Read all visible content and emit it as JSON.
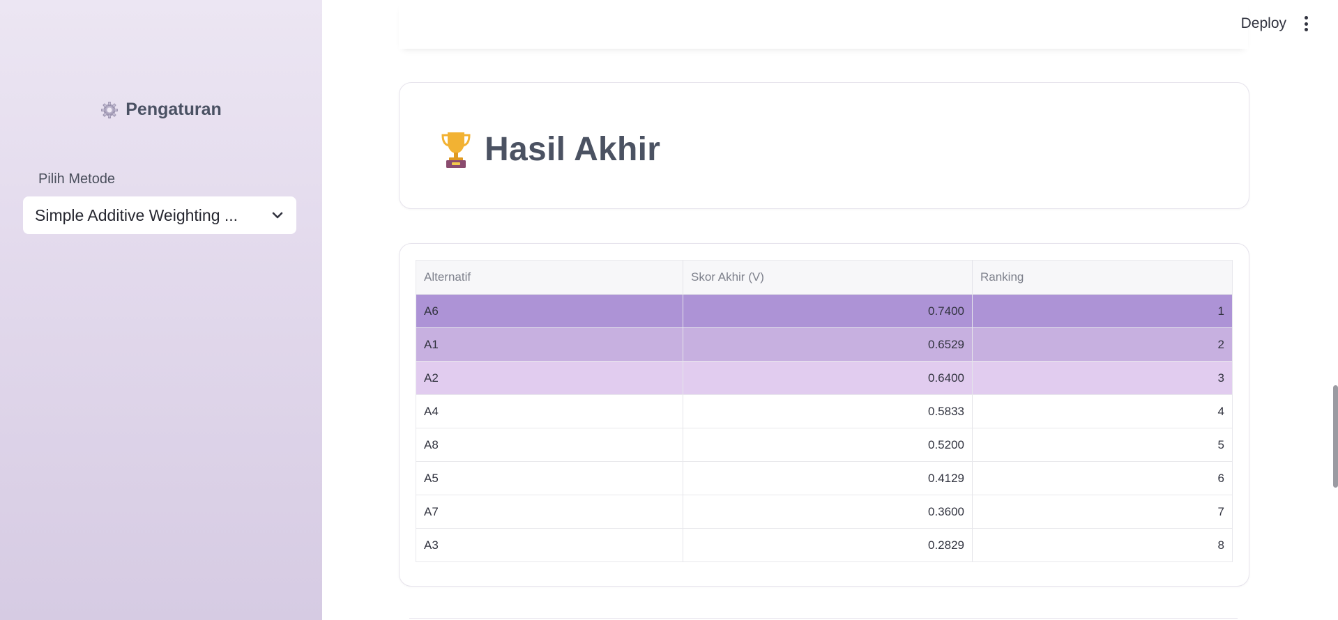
{
  "sidebar": {
    "title": "Pengaturan",
    "title_icon": "gear-icon",
    "select_label": "Pilih Metode",
    "select_value": "Simple Additive Weighting ..."
  },
  "header": {
    "deploy_label": "Deploy",
    "menu_icon": "kebab-menu-icon"
  },
  "main": {
    "title": "Hasil Akhir",
    "title_icon": "trophy-icon",
    "table": {
      "columns": [
        "Alternatif",
        "Skor Akhir (V)",
        "Ranking"
      ],
      "rows": [
        {
          "alt": "A6",
          "score": "0.7400",
          "rank": "1",
          "highlight": "#ad93d6"
        },
        {
          "alt": "A1",
          "score": "0.6529",
          "rank": "2",
          "highlight": "#c7b0e0"
        },
        {
          "alt": "A2",
          "score": "0.6400",
          "rank": "3",
          "highlight": "#e1ccef"
        },
        {
          "alt": "A4",
          "score": "0.5833",
          "rank": "4",
          "highlight": "#ffffff"
        },
        {
          "alt": "A8",
          "score": "0.5200",
          "rank": "5",
          "highlight": "#ffffff"
        },
        {
          "alt": "A5",
          "score": "0.4129",
          "rank": "6",
          "highlight": "#ffffff"
        },
        {
          "alt": "A7",
          "score": "0.3600",
          "rank": "7",
          "highlight": "#ffffff"
        },
        {
          "alt": "A3",
          "score": "0.2829",
          "rank": "8",
          "highlight": "#ffffff"
        }
      ]
    }
  },
  "colors": {
    "sidebar_top": "#ece6f3",
    "sidebar_bottom": "#d6cbe3",
    "title_text": "#4b5262"
  }
}
